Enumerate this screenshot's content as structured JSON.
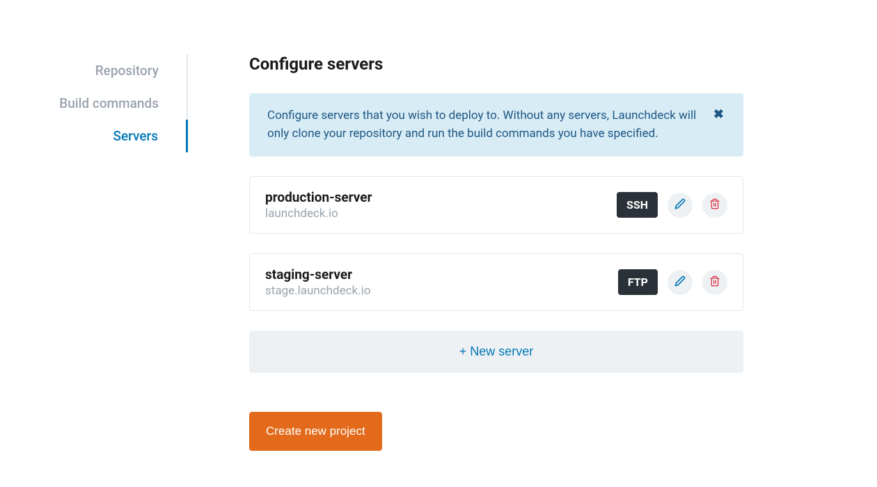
{
  "sidebar": {
    "items": [
      {
        "label": "Repository",
        "active": false
      },
      {
        "label": "Build commands",
        "active": false
      },
      {
        "label": "Servers",
        "active": true
      }
    ]
  },
  "page": {
    "title": "Configure servers"
  },
  "banner": {
    "text": "Configure servers that you wish to deploy to. Without any servers, Launchdeck will only clone your repository and run the build commands you have specified."
  },
  "servers": [
    {
      "name": "production-server",
      "host": "launchdeck.io",
      "protocol": "SSH"
    },
    {
      "name": "staging-server",
      "host": "stage.launchdeck.io",
      "protocol": "FTP"
    }
  ],
  "buttons": {
    "new_server": "+ New server",
    "create_project": "Create new project"
  }
}
